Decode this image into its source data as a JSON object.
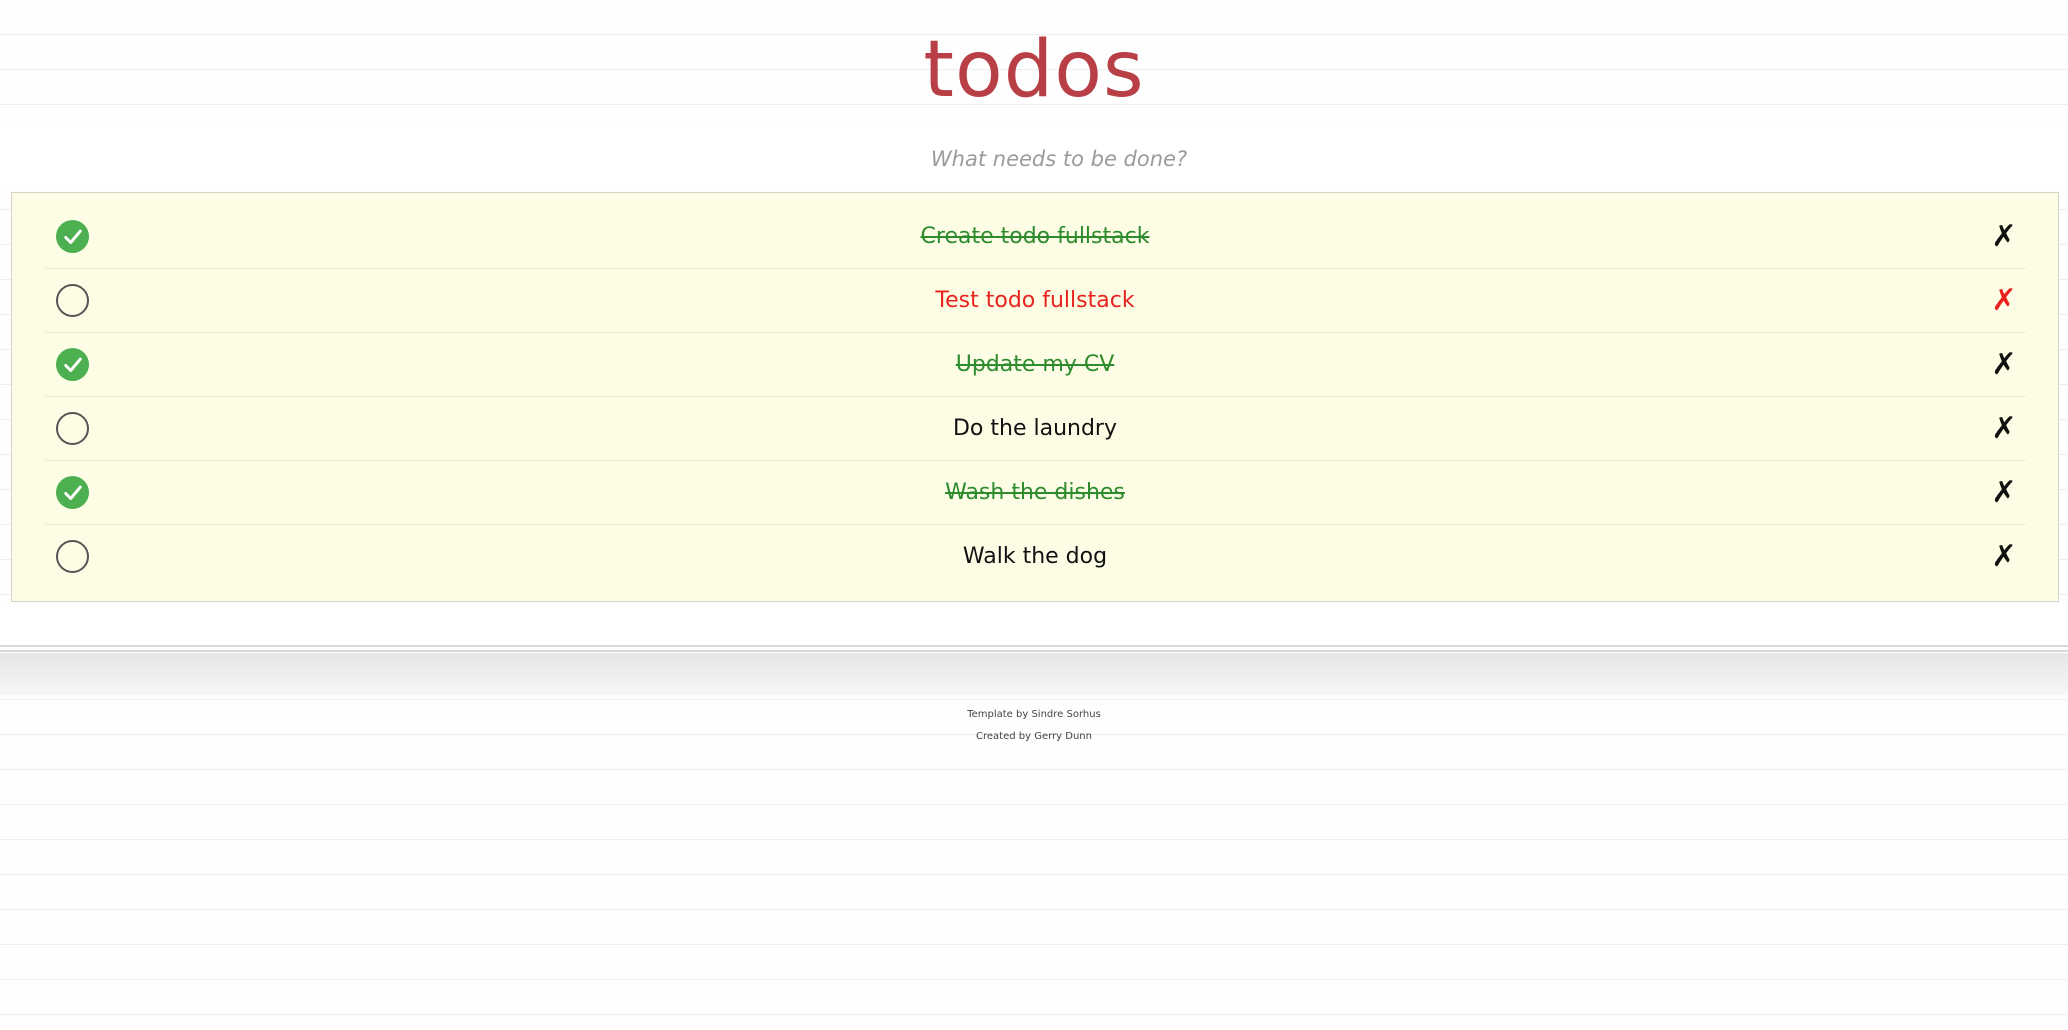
{
  "header": {
    "title": "todos"
  },
  "new_todo": {
    "placeholder": "What needs to be done?"
  },
  "todos": [
    {
      "label": "Create todo fullstack",
      "completed": true,
      "highlighted": false,
      "delete_label": "✗"
    },
    {
      "label": "Test todo fullstack",
      "completed": false,
      "highlighted": true,
      "delete_label": "✗"
    },
    {
      "label": "Update my CV",
      "completed": true,
      "highlighted": false,
      "delete_label": "✗"
    },
    {
      "label": "Do the laundry",
      "completed": false,
      "highlighted": false,
      "delete_label": "✗"
    },
    {
      "label": "Wash the dishes",
      "completed": true,
      "highlighted": false,
      "delete_label": "✗"
    },
    {
      "label": "Walk the dog",
      "completed": false,
      "highlighted": false,
      "delete_label": "✗"
    }
  ],
  "footer": {
    "template_credit": "Template by Sindre Sorhus",
    "created_credit": "Created by Gerry Dunn"
  },
  "colors": {
    "title": "#b83f45",
    "completed_text": "#2e8b2e",
    "highlighted_text": "#e8231f",
    "checkmark_fill": "#4caf50",
    "list_background": "#fdfde6"
  },
  "icons": {
    "checked": "check-circle-icon",
    "unchecked": "empty-circle-icon",
    "delete": "close-icon"
  }
}
